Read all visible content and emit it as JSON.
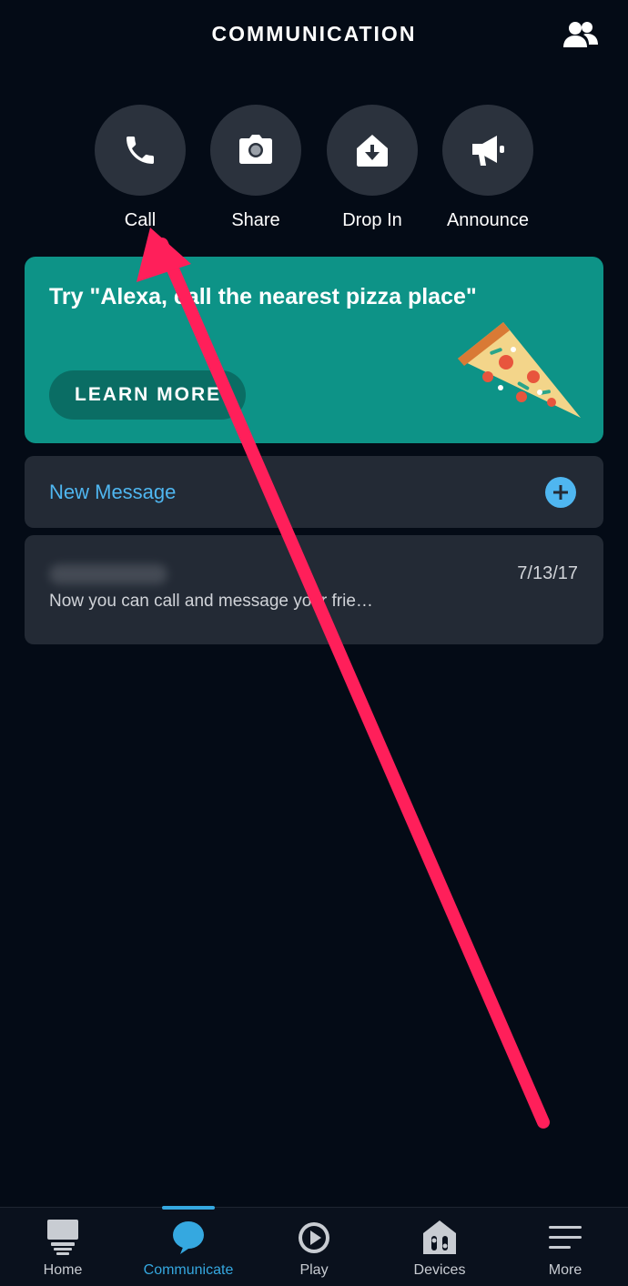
{
  "header": {
    "title": "COMMUNICATION",
    "contacts_icon": "contacts-icon"
  },
  "actions": [
    {
      "label": "Call",
      "icon": "phone-icon"
    },
    {
      "label": "Share",
      "icon": "camera-icon"
    },
    {
      "label": "Drop In",
      "icon": "drop-in-icon"
    },
    {
      "label": "Announce",
      "icon": "megaphone-icon"
    }
  ],
  "promo": {
    "text": "Try \"Alexa, call the nearest pizza place\"",
    "button_label": "LEARN MORE",
    "image": "pizza-slice-illustration"
  },
  "new_message": {
    "label": "New Message",
    "icon": "plus-circle-icon"
  },
  "conversation": {
    "date": "7/13/17",
    "preview": "Now you can call and message your frie…"
  },
  "bottom_nav": [
    {
      "label": "Home",
      "icon": "home-icon",
      "active": false
    },
    {
      "label": "Communicate",
      "icon": "chat-bubble-icon",
      "active": true
    },
    {
      "label": "Play",
      "icon": "play-icon",
      "active": false
    },
    {
      "label": "Devices",
      "icon": "devices-icon",
      "active": false
    },
    {
      "label": "More",
      "icon": "menu-icon",
      "active": false
    }
  ],
  "colors": {
    "background": "#040b16",
    "card": "#232a35",
    "promo": "#0d9387",
    "accent": "#35a8e0",
    "annotation_arrow": "#ff1f5a"
  }
}
